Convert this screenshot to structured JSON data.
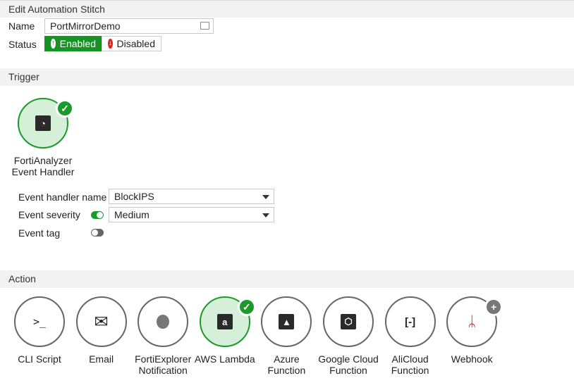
{
  "header": {
    "title": "Edit Automation Stitch"
  },
  "form": {
    "name_label": "Name",
    "name_value": "PortMirrorDemo",
    "status_label": "Status",
    "enabled": "Enabled",
    "disabled": "Disabled",
    "status": "Enabled"
  },
  "trigger": {
    "section": "Trigger",
    "name_line1": "FortiAnalyzer",
    "name_line2": "Event Handler",
    "event_handler_name_label": "Event handler name",
    "event_handler_name": "BlockIPS",
    "event_severity_label": "Event severity",
    "event_severity": "Medium",
    "event_severity_enabled": true,
    "event_tag_label": "Event tag",
    "event_tag_enabled": false
  },
  "action": {
    "section": "Action",
    "items": [
      {
        "l1": "CLI Script",
        "l2": "",
        "icon": "terminal-icon"
      },
      {
        "l1": "Email",
        "l2": "",
        "icon": "envelope-icon"
      },
      {
        "l1": "FortiExplorer",
        "l2": "Notification",
        "icon": "apple-icon"
      },
      {
        "l1": "AWS Lambda",
        "l2": "",
        "icon": "amazon-icon",
        "selected": true
      },
      {
        "l1": "Azure",
        "l2": "Function",
        "icon": "azure-icon"
      },
      {
        "l1": "Google Cloud",
        "l2": "Function",
        "icon": "google-cloud-icon"
      },
      {
        "l1": "AliCloud",
        "l2": "Function",
        "icon": "alicloud-icon"
      },
      {
        "l1": "Webhook",
        "l2": "",
        "icon": "webhook-icon"
      }
    ]
  },
  "colors": {
    "accent": "#1b9a2c",
    "disabled": "#d62828"
  }
}
